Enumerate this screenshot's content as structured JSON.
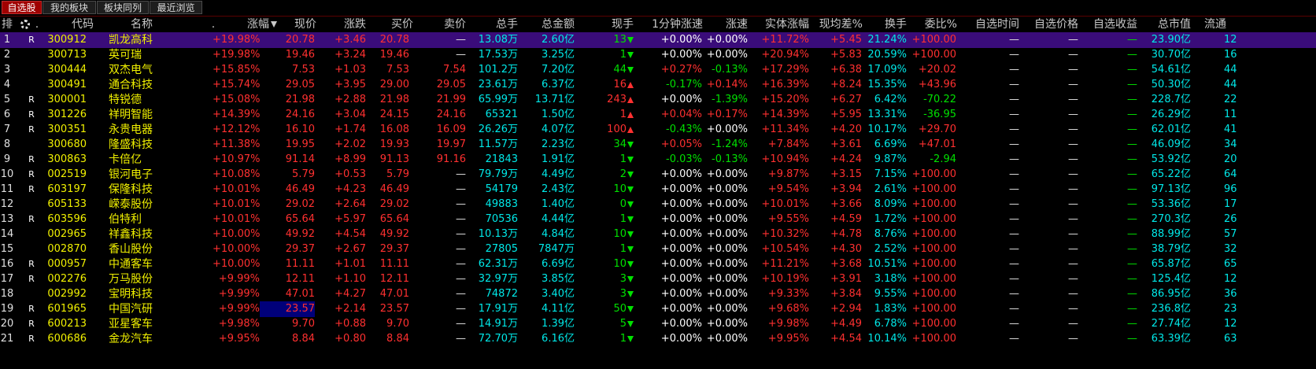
{
  "tabs": [
    "自选股",
    "我的板块",
    "板块同列",
    "最近浏览"
  ],
  "header": {
    "sort_col": "排",
    "dot": ".",
    "columns": [
      "代码",
      "名称",
      "涨幅",
      "现价",
      "涨跌",
      "买价",
      "卖价",
      "总手",
      "总金额",
      "现手",
      "1分钟涨速",
      "涨速",
      "实体涨幅",
      "现均差%",
      "换手",
      "委比%",
      "自选时间",
      "自选价格",
      "自选收益",
      "总市值",
      "流通"
    ]
  },
  "colors": {
    "up": "#ff3030",
    "down": "#00e000",
    "neutral": "#ffffff",
    "cyan": "#00e8e8",
    "yellow": "#f0f000",
    "selected_row": "#3a0c7a"
  },
  "rows": [
    {
      "idx": "1",
      "flag": "R",
      "code": "300912",
      "name": "凯龙高科",
      "chg": "+19.98%",
      "price": "20.78",
      "diff": "+3.46",
      "bid": "20.78",
      "ask": "—",
      "vol": "13.08万",
      "amt": "2.60亿",
      "cur": "13",
      "dir": "down",
      "m1": "+0.00%",
      "spd": "+0.00%",
      "body": "+11.72%",
      "avgdiff": "+5.45",
      "turn": "21.24%",
      "ratio": "+100.00",
      "t": "—",
      "p": "—",
      "g": "—",
      "mcap": "23.90亿",
      "flt": "12",
      "m1c": "n",
      "spdc": "n",
      "ratioc": "u",
      "selected": true
    },
    {
      "idx": "2",
      "flag": "",
      "code": "300713",
      "name": "英可瑞",
      "chg": "+19.98%",
      "price": "19.46",
      "diff": "+3.24",
      "bid": "19.46",
      "ask": "—",
      "vol": "17.53万",
      "amt": "3.25亿",
      "cur": "1",
      "dir": "down",
      "m1": "+0.00%",
      "spd": "+0.00%",
      "body": "+20.94%",
      "avgdiff": "+5.83",
      "turn": "20.59%",
      "ratio": "+100.00",
      "t": "—",
      "p": "—",
      "g": "—",
      "mcap": "30.70亿",
      "flt": "16",
      "m1c": "n",
      "spdc": "n",
      "ratioc": "u"
    },
    {
      "idx": "3",
      "flag": "",
      "code": "300444",
      "name": "双杰电气",
      "chg": "+15.85%",
      "price": "7.53",
      "diff": "+1.03",
      "bid": "7.53",
      "ask": "7.54",
      "vol": "101.2万",
      "amt": "7.20亿",
      "cur": "44",
      "dir": "down",
      "m1": "+0.27%",
      "spd": "-0.13%",
      "body": "+17.29%",
      "avgdiff": "+6.38",
      "turn": "17.09%",
      "ratio": "+20.02",
      "t": "—",
      "p": "—",
      "g": "—",
      "mcap": "54.61亿",
      "flt": "44",
      "m1c": "u",
      "spdc": "d",
      "ratioc": "u"
    },
    {
      "idx": "4",
      "flag": "",
      "code": "300491",
      "name": "通合科技",
      "chg": "+15.74%",
      "price": "29.05",
      "diff": "+3.95",
      "bid": "29.00",
      "ask": "29.05",
      "vol": "23.61万",
      "amt": "6.37亿",
      "cur": "16",
      "dir": "up",
      "m1": "-0.17%",
      "spd": "+0.14%",
      "body": "+16.39%",
      "avgdiff": "+8.24",
      "turn": "15.35%",
      "ratio": "+43.96",
      "t": "—",
      "p": "—",
      "g": "—",
      "mcap": "50.30亿",
      "flt": "44",
      "m1c": "d",
      "spdc": "u",
      "ratioc": "u"
    },
    {
      "idx": "5",
      "flag": "R",
      "code": "300001",
      "name": "特锐德",
      "chg": "+15.08%",
      "price": "21.98",
      "diff": "+2.88",
      "bid": "21.98",
      "ask": "21.99",
      "vol": "65.99万",
      "amt": "13.71亿",
      "cur": "243",
      "dir": "up",
      "m1": "+0.00%",
      "spd": "-1.39%",
      "body": "+15.20%",
      "avgdiff": "+6.27",
      "turn": "6.42%",
      "ratio": "-70.22",
      "t": "—",
      "p": "—",
      "g": "—",
      "mcap": "228.7亿",
      "flt": "22",
      "m1c": "n",
      "spdc": "d",
      "ratioc": "d"
    },
    {
      "idx": "6",
      "flag": "R",
      "code": "301226",
      "name": "祥明智能",
      "chg": "+14.39%",
      "price": "24.16",
      "diff": "+3.04",
      "bid": "24.15",
      "ask": "24.16",
      "vol": "65321",
      "amt": "1.50亿",
      "cur": "1",
      "dir": "up",
      "m1": "+0.04%",
      "spd": "+0.17%",
      "body": "+14.39%",
      "avgdiff": "+5.95",
      "turn": "13.31%",
      "ratio": "-36.95",
      "t": "—",
      "p": "—",
      "g": "—",
      "mcap": "26.29亿",
      "flt": "11",
      "m1c": "u",
      "spdc": "u",
      "ratioc": "d"
    },
    {
      "idx": "7",
      "flag": "R",
      "code": "300351",
      "name": "永贵电器",
      "chg": "+12.12%",
      "price": "16.10",
      "diff": "+1.74",
      "bid": "16.08",
      "ask": "16.09",
      "vol": "26.26万",
      "amt": "4.07亿",
      "cur": "100",
      "dir": "up",
      "m1": "-0.43%",
      "spd": "+0.00%",
      "body": "+11.34%",
      "avgdiff": "+4.20",
      "turn": "10.17%",
      "ratio": "+29.70",
      "t": "—",
      "p": "—",
      "g": "—",
      "mcap": "62.01亿",
      "flt": "41",
      "m1c": "d",
      "spdc": "n",
      "ratioc": "u"
    },
    {
      "idx": "8",
      "flag": "",
      "code": "300680",
      "name": "隆盛科技",
      "chg": "+11.38%",
      "price": "19.95",
      "diff": "+2.02",
      "bid": "19.93",
      "ask": "19.97",
      "vol": "11.57万",
      "amt": "2.23亿",
      "cur": "34",
      "dir": "down",
      "m1": "+0.05%",
      "spd": "-1.24%",
      "body": "+7.84%",
      "avgdiff": "+3.61",
      "turn": "6.69%",
      "ratio": "+47.01",
      "t": "—",
      "p": "—",
      "g": "—",
      "mcap": "46.09亿",
      "flt": "34",
      "m1c": "u",
      "spdc": "d",
      "ratioc": "u"
    },
    {
      "idx": "9",
      "flag": "R",
      "code": "300863",
      "name": "卡倍亿",
      "chg": "+10.97%",
      "price": "91.14",
      "diff": "+8.99",
      "bid": "91.13",
      "ask": "91.16",
      "vol": "21843",
      "amt": "1.91亿",
      "cur": "1",
      "dir": "down",
      "m1": "-0.03%",
      "spd": "-0.13%",
      "body": "+10.94%",
      "avgdiff": "+4.24",
      "turn": "9.87%",
      "ratio": "-2.94",
      "t": "—",
      "p": "—",
      "g": "—",
      "mcap": "53.92亿",
      "flt": "20",
      "m1c": "d",
      "spdc": "d",
      "ratioc": "d"
    },
    {
      "idx": "10",
      "flag": "R",
      "code": "002519",
      "name": "银河电子",
      "chg": "+10.08%",
      "price": "5.79",
      "diff": "+0.53",
      "bid": "5.79",
      "ask": "—",
      "vol": "79.79万",
      "amt": "4.49亿",
      "cur": "2",
      "dir": "down",
      "m1": "+0.00%",
      "spd": "+0.00%",
      "body": "+9.87%",
      "avgdiff": "+3.15",
      "turn": "7.15%",
      "ratio": "+100.00",
      "t": "—",
      "p": "—",
      "g": "—",
      "mcap": "65.22亿",
      "flt": "64",
      "m1c": "n",
      "spdc": "n",
      "ratioc": "u"
    },
    {
      "idx": "11",
      "flag": "R",
      "code": "603197",
      "name": "保隆科技",
      "chg": "+10.01%",
      "price": "46.49",
      "diff": "+4.23",
      "bid": "46.49",
      "ask": "—",
      "vol": "54179",
      "amt": "2.43亿",
      "cur": "10",
      "dir": "down",
      "m1": "+0.00%",
      "spd": "+0.00%",
      "body": "+9.54%",
      "avgdiff": "+3.94",
      "turn": "2.61%",
      "ratio": "+100.00",
      "t": "—",
      "p": "—",
      "g": "—",
      "mcap": "97.13亿",
      "flt": "96",
      "m1c": "n",
      "spdc": "n",
      "ratioc": "u"
    },
    {
      "idx": "12",
      "flag": "",
      "code": "605133",
      "name": "嵘泰股份",
      "chg": "+10.01%",
      "price": "29.02",
      "diff": "+2.64",
      "bid": "29.02",
      "ask": "—",
      "vol": "49883",
      "amt": "1.40亿",
      "cur": "0",
      "dir": "down",
      "m1": "+0.00%",
      "spd": "+0.00%",
      "body": "+10.01%",
      "avgdiff": "+3.66",
      "turn": "8.09%",
      "ratio": "+100.00",
      "t": "—",
      "p": "—",
      "g": "—",
      "mcap": "53.36亿",
      "flt": "17",
      "m1c": "n",
      "spdc": "n",
      "ratioc": "u"
    },
    {
      "idx": "13",
      "flag": "R",
      "code": "603596",
      "name": "伯特利",
      "chg": "+10.01%",
      "price": "65.64",
      "diff": "+5.97",
      "bid": "65.64",
      "ask": "—",
      "vol": "70536",
      "amt": "4.44亿",
      "cur": "1",
      "dir": "down",
      "m1": "+0.00%",
      "spd": "+0.00%",
      "body": "+9.55%",
      "avgdiff": "+4.59",
      "turn": "1.72%",
      "ratio": "+100.00",
      "t": "—",
      "p": "—",
      "g": "—",
      "mcap": "270.3亿",
      "flt": "26",
      "m1c": "n",
      "spdc": "n",
      "ratioc": "u"
    },
    {
      "idx": "14",
      "flag": "",
      "code": "002965",
      "name": "祥鑫科技",
      "chg": "+10.00%",
      "price": "49.92",
      "diff": "+4.54",
      "bid": "49.92",
      "ask": "—",
      "vol": "10.13万",
      "amt": "4.84亿",
      "cur": "10",
      "dir": "down",
      "m1": "+0.00%",
      "spd": "+0.00%",
      "body": "+10.32%",
      "avgdiff": "+4.78",
      "turn": "8.76%",
      "ratio": "+100.00",
      "t": "—",
      "p": "—",
      "g": "—",
      "mcap": "88.99亿",
      "flt": "57",
      "m1c": "n",
      "spdc": "n",
      "ratioc": "u"
    },
    {
      "idx": "15",
      "flag": "",
      "code": "002870",
      "name": "香山股份",
      "chg": "+10.00%",
      "price": "29.37",
      "diff": "+2.67",
      "bid": "29.37",
      "ask": "—",
      "vol": "27805",
      "amt": "7847万",
      "cur": "1",
      "dir": "down",
      "m1": "+0.00%",
      "spd": "+0.00%",
      "body": "+10.54%",
      "avgdiff": "+4.30",
      "turn": "2.52%",
      "ratio": "+100.00",
      "t": "—",
      "p": "—",
      "g": "—",
      "mcap": "38.79亿",
      "flt": "32",
      "m1c": "n",
      "spdc": "n",
      "ratioc": "u"
    },
    {
      "idx": "16",
      "flag": "R",
      "code": "000957",
      "name": "中通客车",
      "chg": "+10.00%",
      "price": "11.11",
      "diff": "+1.01",
      "bid": "11.11",
      "ask": "—",
      "vol": "62.31万",
      "amt": "6.69亿",
      "cur": "10",
      "dir": "down",
      "m1": "+0.00%",
      "spd": "+0.00%",
      "body": "+11.21%",
      "avgdiff": "+3.68",
      "turn": "10.51%",
      "ratio": "+100.00",
      "t": "—",
      "p": "—",
      "g": "—",
      "mcap": "65.87亿",
      "flt": "65",
      "m1c": "n",
      "spdc": "n",
      "ratioc": "u"
    },
    {
      "idx": "17",
      "flag": "R",
      "code": "002276",
      "name": "万马股份",
      "chg": "+9.99%",
      "price": "12.11",
      "diff": "+1.10",
      "bid": "12.11",
      "ask": "—",
      "vol": "32.97万",
      "amt": "3.85亿",
      "cur": "3",
      "dir": "down",
      "m1": "+0.00%",
      "spd": "+0.00%",
      "body": "+10.19%",
      "avgdiff": "+3.91",
      "turn": "3.18%",
      "ratio": "+100.00",
      "t": "—",
      "p": "—",
      "g": "—",
      "mcap": "125.4亿",
      "flt": "12",
      "m1c": "n",
      "spdc": "n",
      "ratioc": "u"
    },
    {
      "idx": "18",
      "flag": "",
      "code": "002992",
      "name": "宝明科技",
      "chg": "+9.99%",
      "price": "47.01",
      "diff": "+4.27",
      "bid": "47.01",
      "ask": "—",
      "vol": "74872",
      "amt": "3.40亿",
      "cur": "3",
      "dir": "down",
      "m1": "+0.00%",
      "spd": "+0.00%",
      "body": "+9.33%",
      "avgdiff": "+3.84",
      "turn": "9.55%",
      "ratio": "+100.00",
      "t": "—",
      "p": "—",
      "g": "—",
      "mcap": "86.95亿",
      "flt": "36",
      "m1c": "n",
      "spdc": "n",
      "ratioc": "u"
    },
    {
      "idx": "19",
      "flag": "R",
      "code": "601965",
      "name": "中国汽研",
      "chg": "+9.99%",
      "price": "23.57",
      "diff": "+2.14",
      "bid": "23.57",
      "ask": "—",
      "vol": "17.91万",
      "amt": "4.11亿",
      "cur": "50",
      "dir": "down",
      "m1": "+0.00%",
      "spd": "+0.00%",
      "body": "+9.68%",
      "avgdiff": "+2.94",
      "turn": "1.83%",
      "ratio": "+100.00",
      "t": "—",
      "p": "—",
      "g": "—",
      "mcap": "236.8亿",
      "flt": "23",
      "m1c": "n",
      "spdc": "n",
      "ratioc": "u",
      "price_hl": true
    },
    {
      "idx": "20",
      "flag": "R",
      "code": "600213",
      "name": "亚星客车",
      "chg": "+9.98%",
      "price": "9.70",
      "diff": "+0.88",
      "bid": "9.70",
      "ask": "—",
      "vol": "14.91万",
      "amt": "1.39亿",
      "cur": "5",
      "dir": "down",
      "m1": "+0.00%",
      "spd": "+0.00%",
      "body": "+9.98%",
      "avgdiff": "+4.49",
      "turn": "6.78%",
      "ratio": "+100.00",
      "t": "—",
      "p": "—",
      "g": "—",
      "mcap": "27.74亿",
      "flt": "12",
      "m1c": "n",
      "spdc": "n",
      "ratioc": "u"
    },
    {
      "idx": "21",
      "flag": "R",
      "code": "600686",
      "name": "金龙汽车",
      "chg": "+9.95%",
      "price": "8.84",
      "diff": "+0.80",
      "bid": "8.84",
      "ask": "—",
      "vol": "72.70万",
      "amt": "6.16亿",
      "cur": "1",
      "dir": "down",
      "m1": "+0.00%",
      "spd": "+0.00%",
      "body": "+9.95%",
      "avgdiff": "+4.54",
      "turn": "10.14%",
      "ratio": "+100.00",
      "t": "—",
      "p": "—",
      "g": "—",
      "mcap": "63.39亿",
      "flt": "63",
      "m1c": "n",
      "spdc": "n",
      "ratioc": "u"
    }
  ]
}
